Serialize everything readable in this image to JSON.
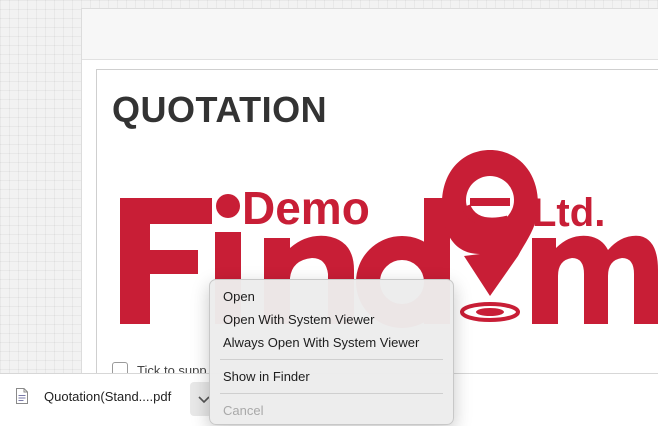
{
  "document": {
    "title": "QUOTATION",
    "tick_label": "Tick to supp"
  },
  "logo": {
    "demo": "Demo",
    "ltd": "Ltd.",
    "brand_color": "#c81e36"
  },
  "download_bar": {
    "file_name": "Quotation(Stand....pdf",
    "icon": "pdf-file-icon"
  },
  "context_menu": {
    "items": [
      {
        "label": "Open"
      },
      {
        "label": "Open With System Viewer"
      },
      {
        "label": "Always Open With System Viewer"
      },
      {
        "label": "Show in Finder"
      },
      {
        "label": "Cancel"
      }
    ]
  }
}
